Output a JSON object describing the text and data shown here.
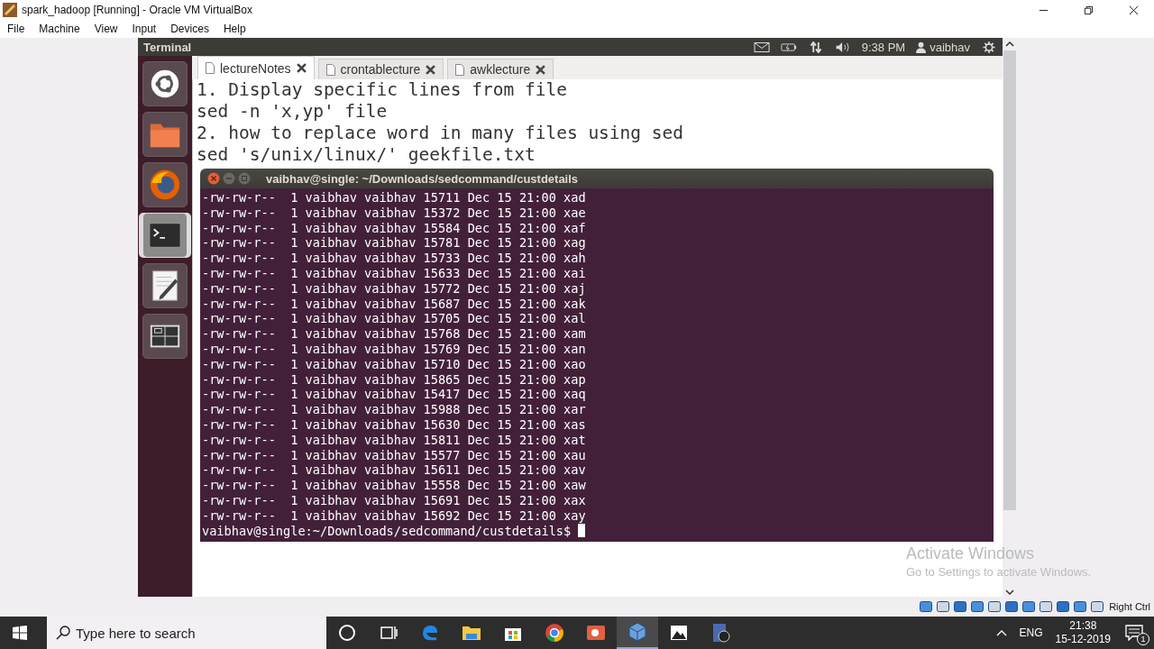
{
  "host_window": {
    "title": "spark_hadoop [Running] - Oracle VM VirtualBox",
    "menu": [
      "File",
      "Machine",
      "View",
      "Input",
      "Devices",
      "Help"
    ]
  },
  "guest": {
    "panel": {
      "app_name": "Terminal",
      "clock": "9:38 PM",
      "user": "vaibhav"
    },
    "launcher": [
      {
        "kind": "ubuntu",
        "selected": false
      },
      {
        "kind": "files",
        "selected": false
      },
      {
        "kind": "firefox",
        "selected": false
      },
      {
        "kind": "terminal",
        "selected": true
      },
      {
        "kind": "editor",
        "selected": false
      },
      {
        "kind": "workspaces",
        "selected": false
      }
    ],
    "editor": {
      "tabs": [
        {
          "label": "lectureNotes",
          "selected": true
        },
        {
          "label": "crontablecture",
          "selected": false
        },
        {
          "label": "awklecture",
          "selected": false
        }
      ],
      "lines": [
        "1. Display specific lines from file",
        "sed -n 'x,yp' file",
        "2. how to replace word in many files using sed",
        "sed 's/unix/linux/' geekfile.txt"
      ]
    },
    "terminal": {
      "title": "vaibhav@single: ~/Downloads/sedcommand/custdetails",
      "lines": [
        "-rw-rw-r--  1 vaibhav vaibhav 15711 Dec 15 21:00 xad",
        "-rw-rw-r--  1 vaibhav vaibhav 15372 Dec 15 21:00 xae",
        "-rw-rw-r--  1 vaibhav vaibhav 15584 Dec 15 21:00 xaf",
        "-rw-rw-r--  1 vaibhav vaibhav 15781 Dec 15 21:00 xag",
        "-rw-rw-r--  1 vaibhav vaibhav 15733 Dec 15 21:00 xah",
        "-rw-rw-r--  1 vaibhav vaibhav 15633 Dec 15 21:00 xai",
        "-rw-rw-r--  1 vaibhav vaibhav 15772 Dec 15 21:00 xaj",
        "-rw-rw-r--  1 vaibhav vaibhav 15687 Dec 15 21:00 xak",
        "-rw-rw-r--  1 vaibhav vaibhav 15705 Dec 15 21:00 xal",
        "-rw-rw-r--  1 vaibhav vaibhav 15768 Dec 15 21:00 xam",
        "-rw-rw-r--  1 vaibhav vaibhav 15769 Dec 15 21:00 xan",
        "-rw-rw-r--  1 vaibhav vaibhav 15710 Dec 15 21:00 xao",
        "-rw-rw-r--  1 vaibhav vaibhav 15865 Dec 15 21:00 xap",
        "-rw-rw-r--  1 vaibhav vaibhav 15417 Dec 15 21:00 xaq",
        "-rw-rw-r--  1 vaibhav vaibhav 15988 Dec 15 21:00 xar",
        "-rw-rw-r--  1 vaibhav vaibhav 15630 Dec 15 21:00 xas",
        "-rw-rw-r--  1 vaibhav vaibhav 15811 Dec 15 21:00 xat",
        "-rw-rw-r--  1 vaibhav vaibhav 15577 Dec 15 21:00 xau",
        "-rw-rw-r--  1 vaibhav vaibhav 15611 Dec 15 21:00 xav",
        "-rw-rw-r--  1 vaibhav vaibhav 15558 Dec 15 21:00 xaw",
        "-rw-rw-r--  1 vaibhav vaibhav 15691 Dec 15 21:00 xax",
        "-rw-rw-r--  1 vaibhav vaibhav 15692 Dec 15 21:00 xay"
      ],
      "prompt": "vaibhav@single:~/Downloads/sedcommand/custdetails$"
    }
  },
  "vbox_status": {
    "host_key": "Right Ctrl"
  },
  "activation": {
    "title": "Activate Windows",
    "text": "Go to Settings to activate Windows."
  },
  "taskbar": {
    "search_placeholder": "Type here to search",
    "apps": [
      {
        "kind": "cortana",
        "selected": false
      },
      {
        "kind": "taskview",
        "selected": false
      },
      {
        "kind": "edge",
        "selected": false
      },
      {
        "kind": "explorer",
        "selected": false
      },
      {
        "kind": "store",
        "selected": false
      },
      {
        "kind": "chrome",
        "selected": false
      },
      {
        "kind": "powerpoint",
        "selected": false
      },
      {
        "kind": "virtualbox",
        "selected": true
      },
      {
        "kind": "photos",
        "selected": false
      },
      {
        "kind": "recorder",
        "selected": false
      }
    ],
    "language": "ENG",
    "time": "21:38",
    "date": "15-12-2019",
    "notifications": "1"
  }
}
